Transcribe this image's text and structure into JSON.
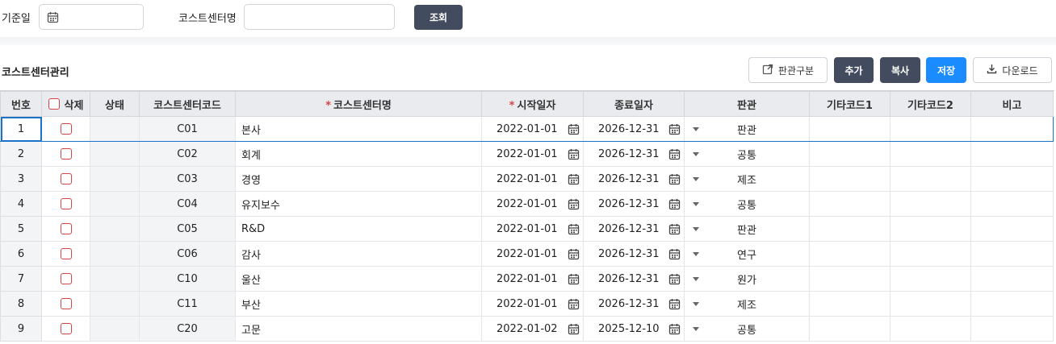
{
  "search": {
    "date_label": "기준일",
    "date_value": "",
    "cc_name_label": "코스트센터명",
    "cc_name_value": "",
    "query_button": "조회"
  },
  "section": {
    "title": "코스트센터관리",
    "buttons": {
      "type": "판관구분",
      "add": "추가",
      "copy": "복사",
      "save": "저장",
      "download": "다운로드"
    }
  },
  "grid": {
    "headers": {
      "no": "번호",
      "delete": "삭제",
      "status": "상태",
      "code": "코스트센터코드",
      "name": "코스트센터명",
      "start": "시작일자",
      "end": "종료일자",
      "sga": "판관",
      "etc1": "기타코드1",
      "etc2": "기타코드2",
      "note": "비고"
    },
    "required_mark": "*",
    "rows": [
      {
        "no": "1",
        "code": "C01",
        "name": "본사",
        "start": "2022-01-01",
        "end": "2026-12-31",
        "sga": "판관",
        "etc1": "",
        "etc2": "",
        "note": ""
      },
      {
        "no": "2",
        "code": "C02",
        "name": "회계",
        "start": "2022-01-01",
        "end": "2026-12-31",
        "sga": "공통",
        "etc1": "",
        "etc2": "",
        "note": ""
      },
      {
        "no": "3",
        "code": "C03",
        "name": "경영",
        "start": "2022-01-01",
        "end": "2026-12-31",
        "sga": "제조",
        "etc1": "",
        "etc2": "",
        "note": ""
      },
      {
        "no": "4",
        "code": "C04",
        "name": "유지보수",
        "start": "2022-01-01",
        "end": "2026-12-31",
        "sga": "공통",
        "etc1": "",
        "etc2": "",
        "note": ""
      },
      {
        "no": "5",
        "code": "C05",
        "name": "R&D",
        "start": "2022-01-01",
        "end": "2026-12-31",
        "sga": "판관",
        "etc1": "",
        "etc2": "",
        "note": ""
      },
      {
        "no": "6",
        "code": "C06",
        "name": "감사",
        "start": "2022-01-01",
        "end": "2026-12-31",
        "sga": "연구",
        "etc1": "",
        "etc2": "",
        "note": ""
      },
      {
        "no": "7",
        "code": "C10",
        "name": "울산",
        "start": "2022-01-01",
        "end": "2026-12-31",
        "sga": "원가",
        "etc1": "",
        "etc2": "",
        "note": ""
      },
      {
        "no": "8",
        "code": "C11",
        "name": "부산",
        "start": "2022-01-01",
        "end": "2026-12-31",
        "sga": "제조",
        "etc1": "",
        "etc2": "",
        "note": ""
      },
      {
        "no": "9",
        "code": "C20",
        "name": "고문",
        "start": "2022-01-02",
        "end": "2025-12-10",
        "sga": "공통",
        "etc1": "",
        "etc2": "",
        "note": ""
      }
    ]
  }
}
